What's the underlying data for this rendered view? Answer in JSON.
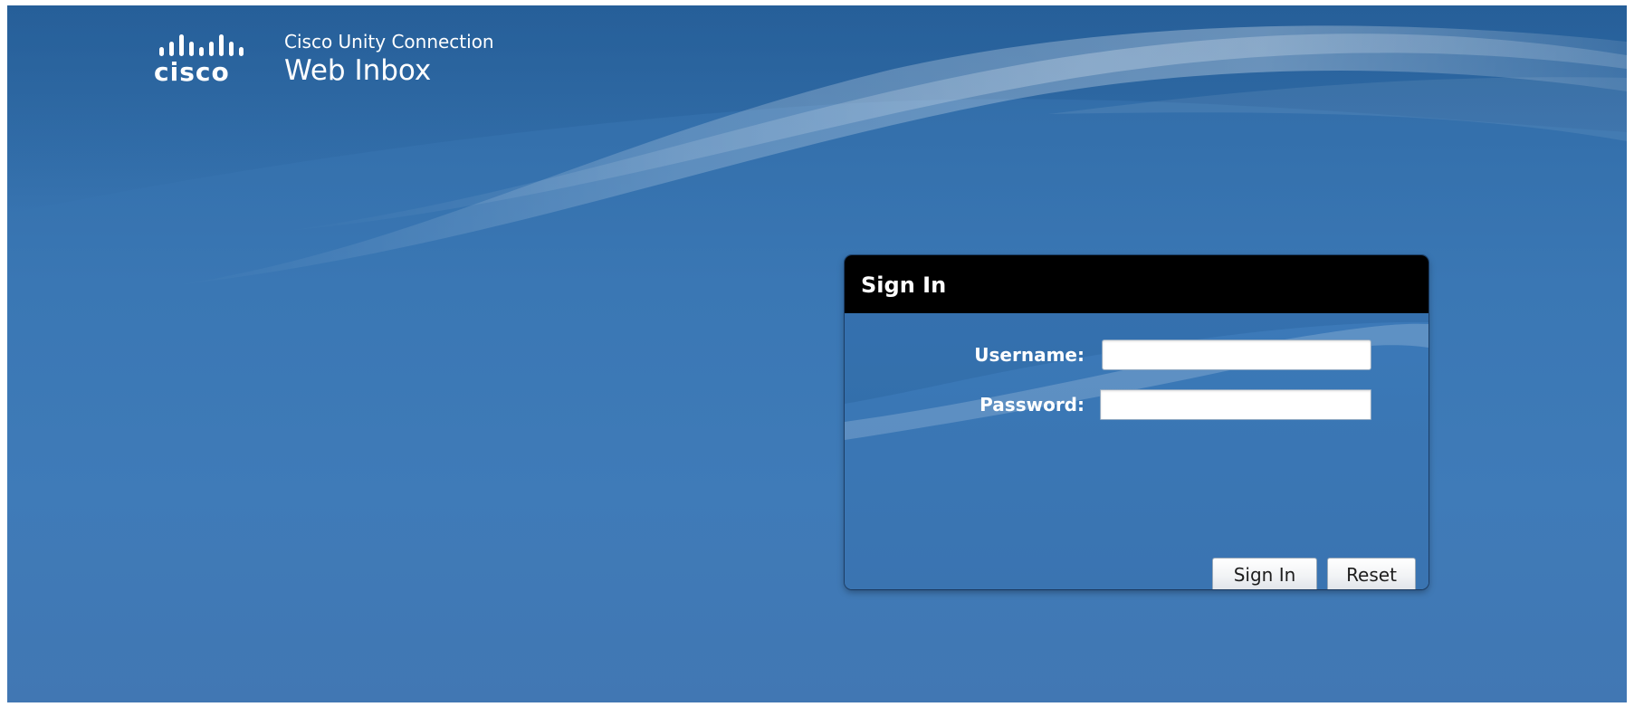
{
  "brand": {
    "logo_text": "cisco",
    "product_name": "Cisco Unity Connection",
    "product_sub": "Web Inbox"
  },
  "signin": {
    "title": "Sign In",
    "username_label": "Username:",
    "password_label": "Password:",
    "username_value": "",
    "password_value": "",
    "signin_button": "Sign In",
    "reset_button": "Reset"
  },
  "colors": {
    "background": "#3a77b4",
    "panel_header": "#000000",
    "button_bg": "#f1f3f5"
  }
}
